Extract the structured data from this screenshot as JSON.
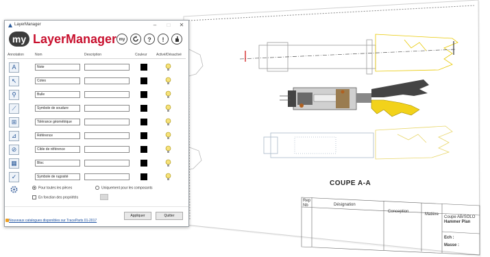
{
  "window": {
    "title": "LayerManager",
    "min_label": "–",
    "max_label": "□",
    "close_label": "✕"
  },
  "brand": {
    "logo_text": "my",
    "title": "LayerManager",
    "btn_my": "my",
    "btn_3": "?",
    "btn_4": "!"
  },
  "columns": {
    "annotation": "Annotation",
    "name": "Nom",
    "description": "Description",
    "color": "Couleur",
    "active": "Activé/Désactivé"
  },
  "rows": [
    {
      "icon": "text-annotation-icon",
      "glyph": "A",
      "name": "Note"
    },
    {
      "icon": "dimension-icon",
      "glyph": "↖",
      "name": "Cotes"
    },
    {
      "icon": "balloon-icon",
      "glyph": "⚲",
      "name": "Bulle"
    },
    {
      "icon": "weld-symbol-icon",
      "glyph": "⟋",
      "name": "Symbole de soudure"
    },
    {
      "icon": "geometric-tolerance-icon",
      "glyph": "⊞",
      "name": "Tolérance géométrique"
    },
    {
      "icon": "datum-icon",
      "glyph": "⊿",
      "name": "Référence"
    },
    {
      "icon": "datum-target-icon",
      "glyph": "⊘",
      "name": "Cible de référence"
    },
    {
      "icon": "table-icon",
      "glyph": "▦",
      "name": "Bloc"
    },
    {
      "icon": "surface-finish-icon",
      "glyph": "✓",
      "name": "Symbole de rugosité"
    }
  ],
  "options": {
    "all_parts": "Pour toutes les pièces",
    "components_only": "Uniquement pour les composants",
    "by_property": "En fonction des propriétés"
  },
  "buttons": {
    "apply": "Appliquer",
    "quit": "Quitter"
  },
  "footer": {
    "link": "Nouveaux catalogues disponibles sur TraceParts 01-2017"
  },
  "drawing": {
    "section_label": "COUPE A-A",
    "tb_designation": "Désignation",
    "tb_company": "Coupe AB/SOLO",
    "tb_sub": "Hammer Plan",
    "tb_matiere": "Matière",
    "tb_ech": "Ech :",
    "tb_masse": "Masse :",
    "tb_ref": "Rep",
    "tb_nb": "Nb",
    "tb_conception": "Conception"
  },
  "colors": {
    "brand_red": "#c8102e",
    "link_blue": "#1a4fa0",
    "drawing_yellow": "#e8c800",
    "drawing_gray": "#9a9a9a"
  }
}
